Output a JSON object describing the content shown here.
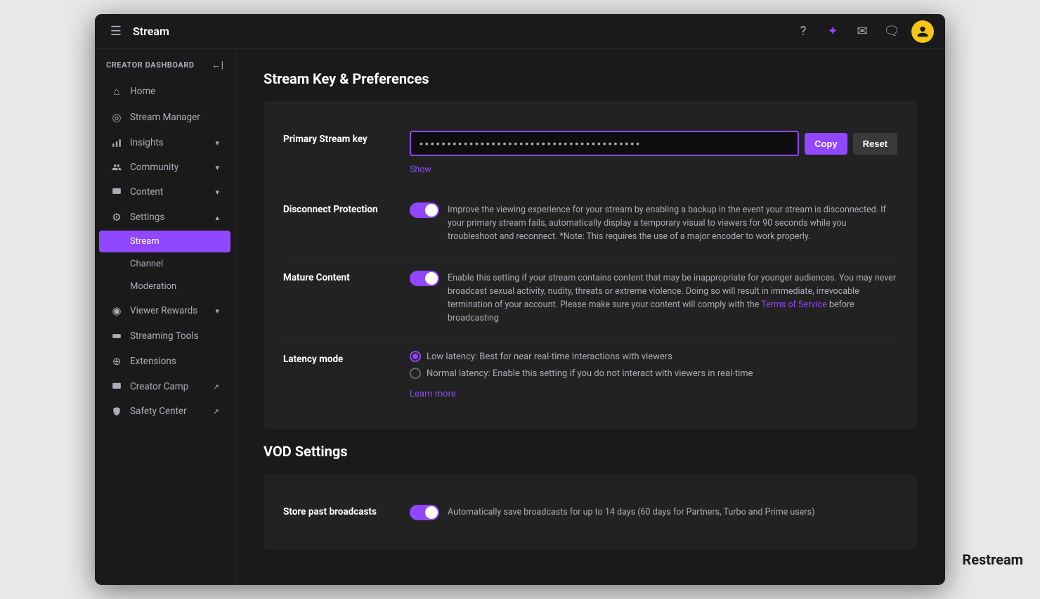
{
  "window": {
    "title": "Stream"
  },
  "titlebar": {
    "icons": {
      "help": "?",
      "star": "✦",
      "mail": "✉",
      "chat": "🗨"
    },
    "avatar_letter": "👤"
  },
  "sidebar": {
    "header_label": "Creator Dashboard",
    "items": [
      {
        "id": "home",
        "label": "Home",
        "icon": "⌂",
        "has_chevron": false,
        "active": false
      },
      {
        "id": "stream-manager",
        "label": "Stream Manager",
        "icon": "◎",
        "has_chevron": false,
        "active": false
      },
      {
        "id": "insights",
        "label": "Insights",
        "icon": "▤",
        "has_chevron": true,
        "active": false
      },
      {
        "id": "community",
        "label": "Community",
        "icon": "⊞",
        "has_chevron": true,
        "active": false
      },
      {
        "id": "content",
        "label": "Content",
        "icon": "▭",
        "has_chevron": true,
        "active": false
      },
      {
        "id": "settings",
        "label": "Settings",
        "icon": "⚙",
        "has_chevron": true,
        "expanded": true,
        "active": false
      }
    ],
    "sub_items": [
      {
        "id": "stream",
        "label": "Stream",
        "active": true
      },
      {
        "id": "channel",
        "label": "Channel",
        "active": false
      },
      {
        "id": "moderation",
        "label": "Moderation",
        "active": false
      }
    ],
    "bottom_items": [
      {
        "id": "viewer-rewards",
        "label": "Viewer Rewards",
        "icon": "◉",
        "has_chevron": true,
        "active": false
      },
      {
        "id": "streaming-tools",
        "label": "Streaming Tools",
        "icon": "▬",
        "has_chevron": false,
        "active": false
      },
      {
        "id": "extensions",
        "label": "Extensions",
        "icon": "⊕",
        "has_chevron": false,
        "active": false
      },
      {
        "id": "creator-camp",
        "label": "Creator Camp",
        "icon": "⛺",
        "has_chevron": false,
        "external": true,
        "active": false
      },
      {
        "id": "safety-center",
        "label": "Safety Center",
        "icon": "⊙",
        "has_chevron": false,
        "external": true,
        "active": false
      }
    ]
  },
  "main": {
    "page_title": "Stream Key & Preferences",
    "stream_key": {
      "label": "Primary Stream key",
      "value": "••••••••••••••••••••••••••••••••••••••••",
      "placeholder": "••••••••••••••••••••••••••••••••••••••••",
      "show_label": "Show",
      "copy_label": "Copy",
      "reset_label": "Reset"
    },
    "disconnect_protection": {
      "label": "Disconnect Protection",
      "enabled": true,
      "description": "Improve the viewing experience for your stream by enabling a backup in the event your stream is disconnected. If your primary stream fails, automatically display a temporary visual to viewers for 90 seconds while you troubleshoot and reconnect. *Note: This requires the use of a major encoder to work properly."
    },
    "mature_content": {
      "label": "Mature Content",
      "enabled": true,
      "description_before": "Enable this setting if your stream contains content that may be inappropriate for younger audiences. You may never broadcast sexual activity, nudity, threats or extreme violence. Doing so will result in immediate, irrevocable termination of your account. Please make sure your content will comply with the ",
      "tos_link": "Terms of Service",
      "description_after": " before broadcasting"
    },
    "latency_mode": {
      "label": "Latency mode",
      "options": [
        {
          "id": "low",
          "label": "Low latency: Best for near real-time interactions with viewers",
          "selected": true
        },
        {
          "id": "normal",
          "label": "Normal latency: Enable this setting if you do not interact with viewers in real-time",
          "selected": false
        }
      ],
      "learn_more_label": "Learn more"
    },
    "vod_title": "VOD Settings",
    "vod": {
      "label": "Store past broadcasts",
      "enabled": true,
      "description": "Automatically save broadcasts for up to 14 days (60 days for Partners, Turbo and Prime users)"
    }
  },
  "watermark": "Restream"
}
